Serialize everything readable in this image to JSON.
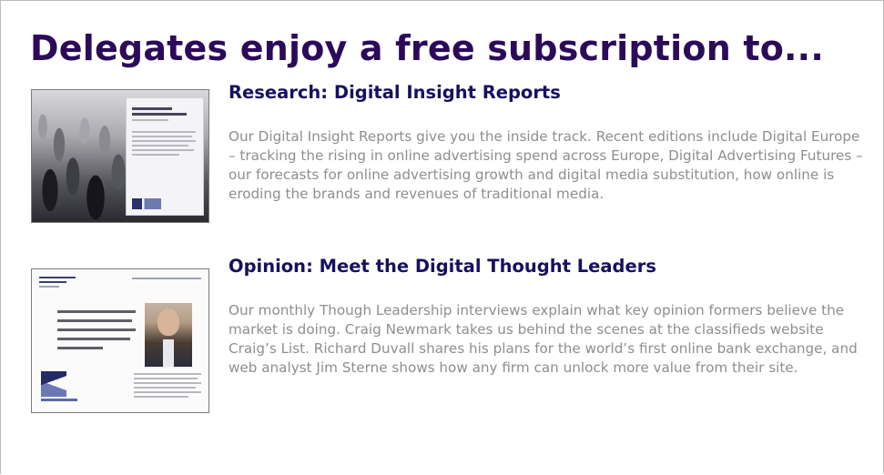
{
  "page": {
    "title": "Delegates enjoy a free subscription to..."
  },
  "sections": [
    {
      "title": "Research: Digital Insight Reports",
      "body": "Our Digital Insight Reports give you the inside track. Recent editions include Digital Europe – tracking the rising in online advertising spend across Europe, Digital Advertising Futures – our forecasts for online advertising growth and digital media substitution, how online is eroding the brands and revenues of traditional media."
    },
    {
      "title": "Opinion: Meet the Digital Thought Leaders",
      "body": "Our monthly Though Leadership interviews explain what key opinion formers believe the market is doing. Craig Newmark takes us behind the scenes at the classifieds website Craig’s List. Richard Duvall shares his plans for the world’s first online bank exchange, and web analyst Jim Sterne shows how any firm can unlock more value from their site."
    }
  ],
  "colors": {
    "title": "#2b0a5a",
    "section_title": "#16105e",
    "body_text": "#8e8e8e"
  }
}
